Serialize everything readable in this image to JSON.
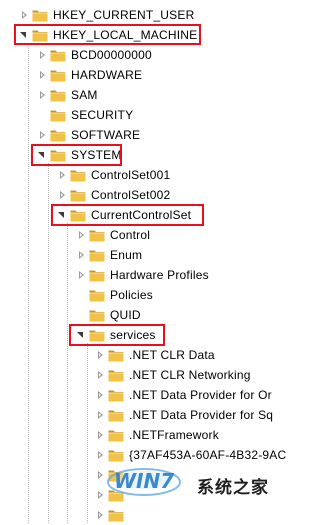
{
  "tree": {
    "nodes": [
      {
        "label": "HKEY_CURRENT_USER",
        "expander": "closed",
        "highlighted": false
      },
      {
        "label": "HKEY_LOCAL_MACHINE",
        "expander": "open",
        "highlighted": true
      },
      {
        "label": "BCD00000000",
        "expander": "closed",
        "highlighted": false
      },
      {
        "label": "HARDWARE",
        "expander": "closed",
        "highlighted": false
      },
      {
        "label": "SAM",
        "expander": "closed",
        "highlighted": false
      },
      {
        "label": "SECURITY",
        "expander": "none",
        "highlighted": false
      },
      {
        "label": "SOFTWARE",
        "expander": "closed",
        "highlighted": false
      },
      {
        "label": "SYSTEM",
        "expander": "open",
        "highlighted": true
      },
      {
        "label": "ControlSet001",
        "expander": "closed",
        "highlighted": false
      },
      {
        "label": "ControlSet002",
        "expander": "closed",
        "highlighted": false
      },
      {
        "label": "CurrentControlSet",
        "expander": "open",
        "highlighted": true
      },
      {
        "label": "Control",
        "expander": "closed",
        "highlighted": false
      },
      {
        "label": "Enum",
        "expander": "closed",
        "highlighted": false
      },
      {
        "label": "Hardware Profiles",
        "expander": "closed",
        "highlighted": false
      },
      {
        "label": "Policies",
        "expander": "none",
        "highlighted": false
      },
      {
        "label": "QUID",
        "expander": "none",
        "highlighted": false
      },
      {
        "label": "services",
        "expander": "open",
        "highlighted": true
      },
      {
        "label": ".NET CLR Data",
        "expander": "closed",
        "highlighted": false
      },
      {
        "label": ".NET CLR Networking",
        "expander": "closed",
        "highlighted": false
      },
      {
        "label": ".NET Data Provider for Or",
        "expander": "closed",
        "highlighted": false
      },
      {
        "label": ".NET Data Provider for Sq",
        "expander": "closed",
        "highlighted": false
      },
      {
        "label": ".NETFramework",
        "expander": "closed",
        "highlighted": false
      },
      {
        "label": "{37AF453A-60AF-4B32-9AC",
        "expander": "closed",
        "highlighted": false
      },
      {
        "label": "",
        "expander": "closed",
        "highlighted": false
      },
      {
        "label": "",
        "expander": "closed",
        "highlighted": false
      },
      {
        "label": "",
        "expander": "closed",
        "highlighted": false
      }
    ]
  },
  "watermark": {
    "text": "系统之家",
    "logo_letters": "WIN7"
  },
  "colors": {
    "highlight": "#e8101e",
    "folder_body": "#f0c24a",
    "folder_dark": "#c99419",
    "guide": "#b9b9b9"
  }
}
